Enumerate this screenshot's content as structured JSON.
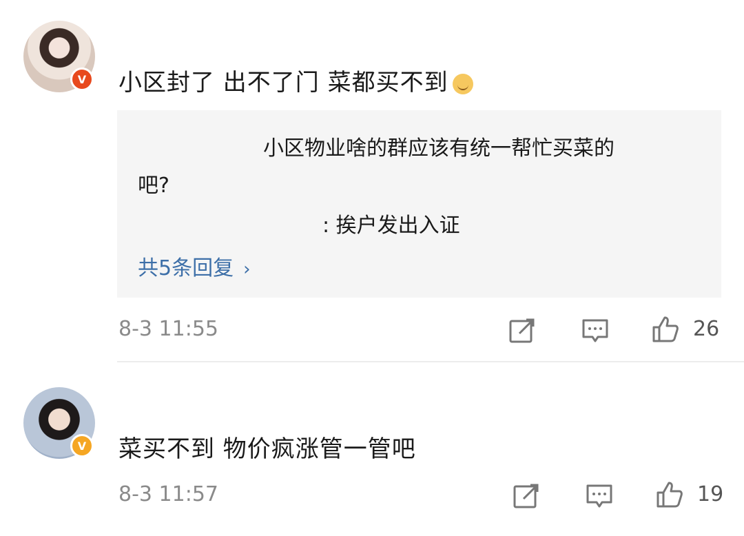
{
  "comments": [
    {
      "text": "小区封了 出不了门 菜都买不到",
      "emoji": "face-emoji",
      "badge": "V",
      "replies": {
        "line1": "小区物业啥的群应该有统一帮忙买菜的",
        "line2": "吧?",
        "line3": ": 挨户发出入证",
        "more_label": "共5条回复",
        "more_chevron": "›"
      },
      "time": "8-3 11:55",
      "likes": "26"
    },
    {
      "text": "菜买不到 物价疯涨管一管吧",
      "badge": "V",
      "time": "8-3 11:57",
      "likes": "19"
    }
  ],
  "colors": {
    "link": "#3d6fa8",
    "meta": "#8a8a8a",
    "reply_bg": "#f5f5f5",
    "badge_red": "#e8491d",
    "badge_gold": "#f5a623"
  }
}
